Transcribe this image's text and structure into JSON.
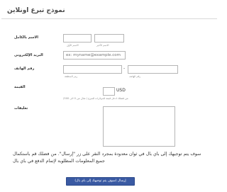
{
  "form": {
    "title": "نموذج تبرع اونلاين",
    "name": {
      "label": "الاسم بالكامل",
      "first_sublabel": "الاسم الأول",
      "last_sublabel": "الاسم الأخير",
      "first_value": "",
      "last_value": ""
    },
    "email": {
      "label": "البريد الإلكتروني",
      "placeholder": "ex: myname@example.com"
    },
    "phone": {
      "label": "رقم الهاتف",
      "area_sublabel": "رمز المنطقة",
      "number_sublabel": "رقم الهاتف",
      "separator": "-"
    },
    "amount": {
      "label": "القيمة",
      "currency": "USD",
      "hint": "من فضلك ادخل قيمة للدولارات للتبرع ( مثال من 0 الى 500)"
    },
    "comments": {
      "label": "تعليقات"
    },
    "notice": "سوف يتم توجيهك إلى باي بال في ثوان معدودة بمجرد النقر على زر \"إرسال\". من فضلك قم باستكمال جميع المعلومات المطلوبة لإتمام الدفع في باي بال",
    "submit_label": "إرسال (سوف يتم توجيهك إلى باي بال)"
  }
}
